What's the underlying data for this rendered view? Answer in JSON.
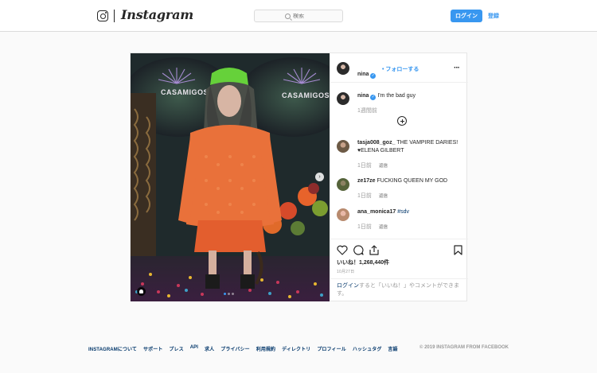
{
  "header": {
    "wordmark": "Instagram",
    "search_placeholder": "検索",
    "login_label": "ログイン",
    "signup_label": "登録"
  },
  "post": {
    "photo": {
      "sign_left": "CASAMIGOS",
      "sign_right": "CASAMIGOS",
      "image_description_icons": [
        "chevron-right-icon",
        "user-tag-icon"
      ],
      "carousel_dots": 3,
      "active_dot": 1
    },
    "author": {
      "username": "nina",
      "follow_label": "フォローする"
    },
    "caption": {
      "username": "nina",
      "text": "I'm the bad guy",
      "time": "1週間前"
    },
    "comments": [
      {
        "username": "tasja008_goz_",
        "text_line1": "THE VAMPIRE DARIES!",
        "text_line2": "♥ELENA GILBERT",
        "time": "1日前",
        "reply": "返信"
      },
      {
        "username": "ze17ze",
        "text_line1": "FUCKING QUEEN MY GOD",
        "time": "1日前",
        "reply": "返信"
      },
      {
        "username": "ana_monica17",
        "text_line1": "#sdv",
        "time": "1日前",
        "reply": "返信"
      }
    ],
    "likes": "いいね！1,268,440件",
    "date": "10月27日",
    "login_prompt": {
      "link": "ログイン",
      "text": "すると「いいね！」やコメントができます。"
    }
  },
  "footer": {
    "links": [
      "INSTAGRAMについて",
      "サポート",
      "プレス",
      "API",
      "求人",
      "プライバシー",
      "利用規約",
      "ディレクトリ",
      "プロフィール",
      "ハッシュタグ",
      "言語"
    ],
    "copyright": "© 2019 INSTAGRAM FROM FACEBOOK"
  },
  "colors": {
    "accent": "#3897f0",
    "link": "#003569",
    "muted": "#999999",
    "border": "#dbdbdb"
  }
}
